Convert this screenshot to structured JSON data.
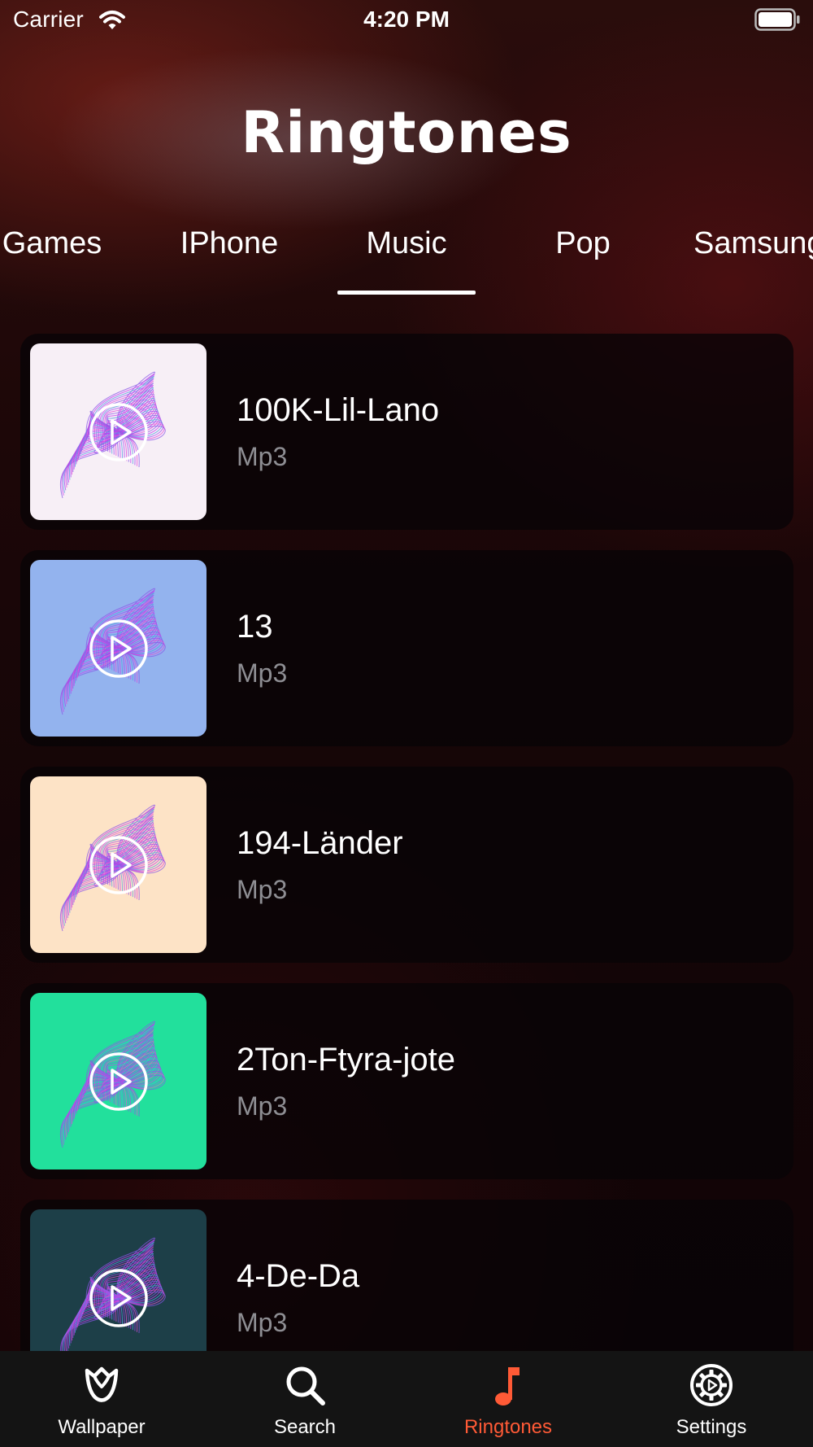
{
  "status_bar": {
    "carrier": "Carrier",
    "time": "4:20 PM"
  },
  "header": {
    "title": "Ringtones"
  },
  "categories": [
    {
      "label": "Games"
    },
    {
      "label": "IPhone"
    },
    {
      "label": "Music",
      "selected": true
    },
    {
      "label": "Pop"
    },
    {
      "label": "Samsung"
    }
  ],
  "ringtones": [
    {
      "title": "100K-Lil-Lano",
      "format": "Mp3",
      "thumb_bg": "#f7eff6",
      "icon": "play-icon"
    },
    {
      "title": "13",
      "format": "Mp3",
      "thumb_bg": "#93b3ee",
      "icon": "play-icon"
    },
    {
      "title": "194-Länder",
      "format": "Mp3",
      "thumb_bg": "#fde3c6",
      "icon": "play-icon"
    },
    {
      "title": "2Ton-Ftyra-jote",
      "format": "Mp3",
      "thumb_bg": "#22e09c",
      "icon": "play-icon"
    },
    {
      "title": "4-De-Da",
      "format": "Mp3",
      "thumb_bg": "#1d3f48",
      "icon": "play-icon"
    }
  ],
  "tab_bar": {
    "items": [
      {
        "label": "Wallpaper",
        "icon": "tulip-icon"
      },
      {
        "label": "Search",
        "icon": "search-icon"
      },
      {
        "label": "Ringtones",
        "icon": "music-note-icon",
        "active": true
      },
      {
        "label": "Settings",
        "icon": "gear-icon"
      }
    ]
  },
  "colors": {
    "accent": "#ff5a36",
    "subtitle": "#8e8e93",
    "tab_bar_bg": "#141414"
  }
}
